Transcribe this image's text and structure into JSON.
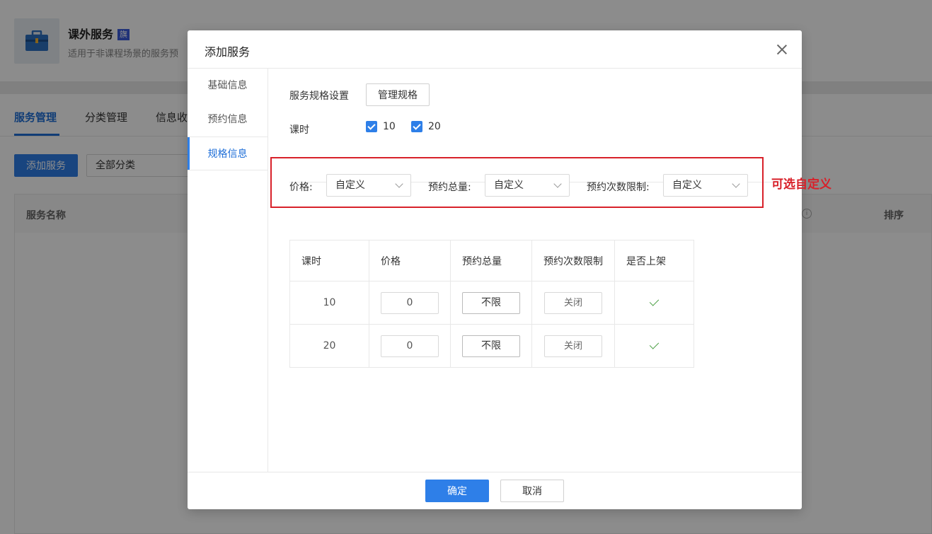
{
  "background": {
    "app": {
      "title": "课外服务",
      "badge": "旗",
      "description": "适用于非课程场景的服务预",
      "icon": "briefcase-icon"
    },
    "tabs": [
      "服务管理",
      "分类管理",
      "信息收"
    ],
    "add_button": "添加服务",
    "category_select": "全部分类",
    "table_headers": {
      "name": "服务名称",
      "sort": "排序",
      "info": "i"
    }
  },
  "modal": {
    "title": "添加服务",
    "side_nav": [
      "基础信息",
      "预约信息",
      "规格信息"
    ],
    "active_nav": "规格信息",
    "spec_settings_label": "服务规格设置",
    "manage_spec_button": "管理规格",
    "hours_label": "课时",
    "hour_options": [
      {
        "label": "10",
        "checked": true
      },
      {
        "label": "20",
        "checked": true
      }
    ],
    "filters": {
      "price_label": "价格:",
      "price_value": "自定义",
      "total_label": "预约总量:",
      "total_value": "自定义",
      "limit_label": "预约次数限制:",
      "limit_value": "自定义"
    },
    "annotation": "可选自定义",
    "table": {
      "headers": [
        "课时",
        "价格",
        "预约总量",
        "预约次数限制",
        "是否上架"
      ],
      "rows": [
        {
          "hours": "10",
          "price": "0",
          "total": "不限",
          "limit": "关闭",
          "listed": true
        },
        {
          "hours": "20",
          "price": "0",
          "total": "不限",
          "limit": "关闭",
          "listed": true
        }
      ]
    },
    "confirm_button": "确定",
    "cancel_button": "取消"
  },
  "colors": {
    "primary": "#2e7fe8",
    "annotation_red": "#d8212a",
    "check_green": "#52a34c"
  }
}
